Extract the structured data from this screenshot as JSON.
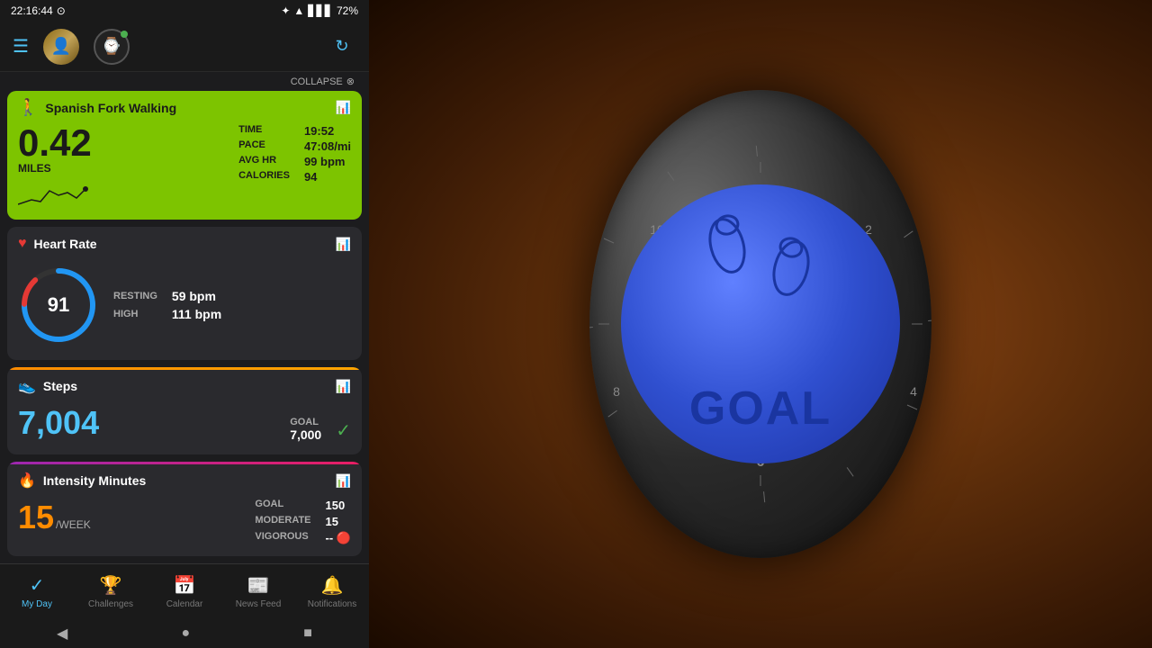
{
  "statusBar": {
    "time": "22:16:44",
    "battery": "72%"
  },
  "topNav": {
    "avatarEmoji": "👤",
    "watchEmoji": "⌚",
    "refreshIcon": "↻"
  },
  "collapseBar": {
    "label": "COLLAPSE"
  },
  "walkingCard": {
    "title": "Spanish Fork Walking",
    "icon": "🚶",
    "miles": "0.42",
    "milesLabel": "MILES",
    "stats": {
      "timeLabel": "TIME",
      "timeValue": "19:52",
      "paceLabel": "PACE",
      "paceValue": "47:08/mi",
      "avgHrLabel": "AVG HR",
      "avgHrValue": "99 bpm",
      "caloriesLabel": "CALORIES",
      "caloriesValue": "94"
    }
  },
  "heartRateCard": {
    "title": "Heart Rate",
    "currentBpm": "91",
    "stats": {
      "restingLabel": "RESTING",
      "restingValue": "59 bpm",
      "highLabel": "HIGH",
      "highValue": "111 bpm"
    }
  },
  "stepsCard": {
    "title": "Steps",
    "icon": "👟",
    "value": "7,004",
    "goalLabel": "GOAL",
    "goalValue": "7,000"
  },
  "intensityCard": {
    "title": "Intensity Minutes",
    "value": "15",
    "unit": "/WEEK",
    "stats": {
      "goalLabel": "GOAL",
      "goalValue": "150",
      "moderateLabel": "MODERATE",
      "moderateValue": "15",
      "vigorousLabel": "VIGOROUS",
      "vigorousValue": "--"
    }
  },
  "bottomNav": {
    "items": [
      {
        "id": "my-day",
        "label": "My Day",
        "icon": "✓",
        "active": true
      },
      {
        "id": "challenges",
        "label": "Challenges",
        "icon": "🏆",
        "active": false
      },
      {
        "id": "calendar",
        "label": "Calendar",
        "icon": "📅",
        "active": false
      },
      {
        "id": "news-feed",
        "label": "News Feed",
        "icon": "📰",
        "active": false
      },
      {
        "id": "notifications",
        "label": "Notifications",
        "icon": "🔔",
        "active": false
      }
    ]
  },
  "watchDisplay": {
    "goalText": "GOAL"
  },
  "colors": {
    "walkingGreen": "#7DC400",
    "heartRed": "#e53935",
    "stepsOrange": "#FF8C00",
    "intensityPurple": "#9C27B0",
    "accent": "#4fc3f7",
    "watchBlue": "#3050d0"
  }
}
